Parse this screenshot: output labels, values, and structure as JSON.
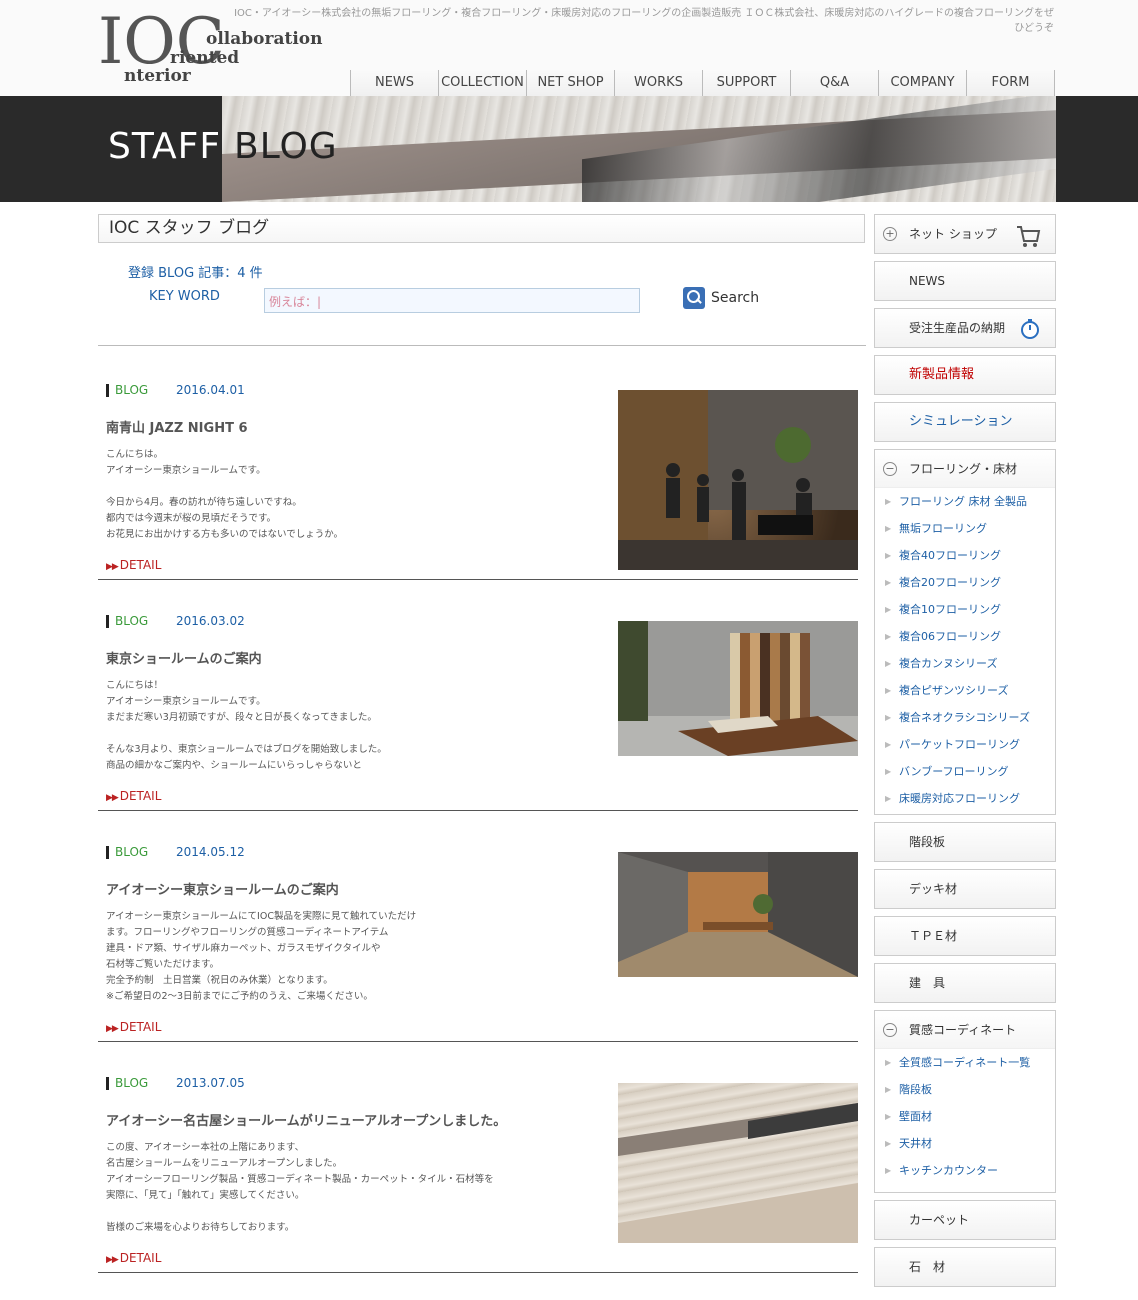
{
  "header": {
    "logo_ioc": "IOC",
    "logo_line1": "ollaboration",
    "logo_line2": "riented",
    "logo_line3": "nterior",
    "tagline": "IOC・アイオーシー株式会社の無垢フローリング・複合フローリング・床暖房対応のフローリングの企画製造販売 ＩＯＣ株式会社、床暖房対応のハイグレードの複合フローリングをぜひどうぞ"
  },
  "nav": [
    "NEWS",
    "COLLECTION",
    "NET SHOP",
    "WORKS",
    "SUPPORT",
    "Q&A",
    "COMPANY",
    "FORM"
  ],
  "banner": {
    "staff": "STAFF",
    "blog": "BLOG"
  },
  "main": {
    "title": "IOC スタッフ ブログ",
    "count": "登録 BLOG 記事：4 件",
    "keyword_label": "KEY WORD",
    "search_placeholder": "例えば：|",
    "search_label": "Search"
  },
  "posts": [
    {
      "category": "BLOG",
      "date": "2016.04.01",
      "title": "南青山 JAZZ NIGHT 6",
      "body": "こんにちは。\nアイオーシー東京ショールームです。\n\n今日から4月。春の訪れが待ち遠しいですね。\n都内では今週末が桜の見頃だそうです。\nお花見にお出かけする方も多いのではないでしょうか。",
      "detail": "DETAIL"
    },
    {
      "category": "BLOG",
      "date": "2016.03.02",
      "title": "東京ショールームのご案内",
      "body": "こんにちは！\nアイオーシー東京ショールームです。\nまだまだ寒い3月初頭ですが、段々と日が長くなってきました。\n\nそんな3月より、東京ショールームではブログを開始致しました。\n商品の細かなご案内や、ショールームにいらっしゃらないと",
      "detail": "DETAIL"
    },
    {
      "category": "BLOG",
      "date": "2014.05.12",
      "title": "アイオーシー東京ショールームのご案内",
      "body": "アイオーシー東京ショールームにてIOC製品を実際に見て触れていただけ\nます。フローリングやフローリングの質感コーディネートアイテム\n建具・ドア類、サイザル麻カーペット、ガラスモザイクタイルや\n石材等ご覧いただけます。\n完全予約制　土日営業（祝日のみ休業）となります。\n※ご希望日の2〜3日前までにご予約のうえ、ご来場ください。",
      "detail": "DETAIL"
    },
    {
      "category": "BLOG",
      "date": "2013.07.05",
      "title": "アイオーシー名古屋ショールームがリニューアルオープンしました。",
      "body": "この度、アイオーシー本社の上階にあります、\n名古屋ショールームをリニューアルオープンしました。\nアイオーシーフローリング製品・質感コーディネート製品・カーペット・タイル・石材等を\n実際に、「見て」「触れて」実感してください。\n\n皆様のご来場を心よりお待ちしております。",
      "detail": "DETAIL"
    }
  ],
  "sidebar": {
    "netshop": "ネット ショップ",
    "news": "NEWS",
    "delivery": "受注生産品の納期",
    "new_products": "新製品情報",
    "simulation": "シミュレーション",
    "flooring_head": "フローリング・床材",
    "flooring_items": [
      "フローリング 床材 全製品",
      "無垢フローリング",
      "複合40フローリング",
      "複合20フローリング",
      "複合10フローリング",
      "複合06フローリング",
      "複合カンヌシリーズ",
      "複合ピザンツシリーズ",
      "複合ネオクラシコシリーズ",
      "パーケットフローリング",
      "バンブーフローリング",
      "床暖房対応フローリング"
    ],
    "stairs": "階段板",
    "deck": "デッキ材",
    "tpe": "ＴＰＥ材",
    "fittings": "建　具",
    "texture_head": "質感コーディネート",
    "texture_items": [
      "全質感コーディネート一覧",
      "階段板",
      "壁面材",
      "天井材",
      "キッチンカウンター"
    ],
    "carpet": "カーペット",
    "stone": "石　材"
  },
  "colors": {
    "accent_blue": "#1d5fa5",
    "detail_red": "#bb2222",
    "blog_green": "#3a9a3a",
    "new_red": "#c00000"
  }
}
